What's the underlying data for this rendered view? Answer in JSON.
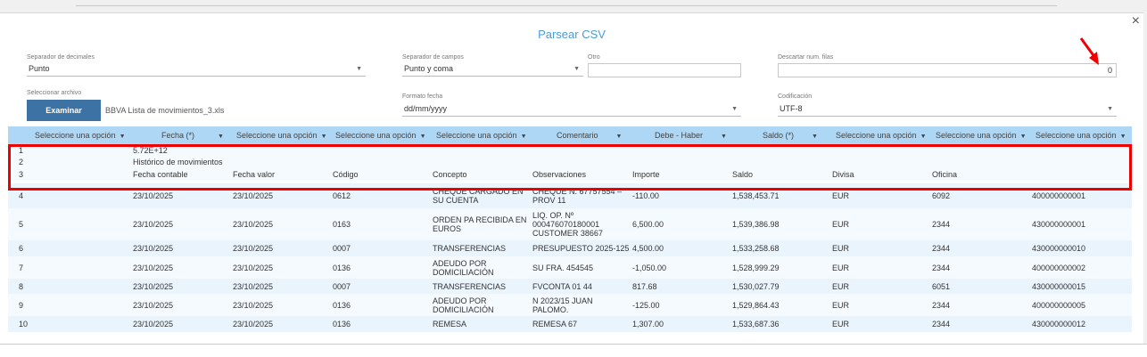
{
  "dialog": {
    "title": "Parsear CSV",
    "close": "×"
  },
  "form": {
    "decimal_sep": {
      "label": "Separador de decimales",
      "value": "Punto"
    },
    "field_sep": {
      "label": "Separador de campos",
      "value": "Punto y coma"
    },
    "other": {
      "label": "Otro",
      "value": ""
    },
    "skip_rows": {
      "label": "Descartar num. filas",
      "value": "0"
    },
    "file": {
      "label": "Seleccionar archivo",
      "button": "Examinar",
      "filename": "BBVA Lista de movimientos_3.xls"
    },
    "date_format": {
      "label": "Formato fecha",
      "value": "dd/mm/yyyy"
    },
    "encoding": {
      "label": "Codificación",
      "value": "UTF-8"
    }
  },
  "columns": [
    {
      "label": "Seleccione una opción"
    },
    {
      "label": "Fecha (*)"
    },
    {
      "label": "Seleccione una opción"
    },
    {
      "label": "Seleccione una opción"
    },
    {
      "label": "Seleccione una opción"
    },
    {
      "label": "Comentario"
    },
    {
      "label": "Debe - Haber"
    },
    {
      "label": "Saldo (*)"
    },
    {
      "label": "Seleccione una opción"
    },
    {
      "label": "Seleccione una opción"
    },
    {
      "label": "Seleccione una opción"
    }
  ],
  "rows": [
    [
      "1",
      "5.72E+12",
      "",
      "",
      "",
      "",
      "",
      "",
      "",
      "",
      ""
    ],
    [
      "2",
      "Histórico de movimientos",
      "",
      "",
      "",
      "",
      "",
      "",
      "",
      "",
      ""
    ],
    [
      "3",
      "Fecha contable",
      "Fecha valor",
      "Código",
      "Concepto",
      "Observaciones",
      "Importe",
      "Saldo",
      "Divisa",
      "Oficina",
      ""
    ],
    [
      "4",
      "23/10/2025",
      "23/10/2025",
      "0612",
      "CHEQUE CARGADO EN SU CUENTA",
      "CHEQUE N. 67757554 – PROV 11",
      "-110.00",
      "1,538,453.71",
      "EUR",
      "6092",
      "400000000001"
    ],
    [
      "5",
      "23/10/2025",
      "23/10/2025",
      "0163",
      "ORDEN PA RECIBIDA EN EUROS",
      "LIQ. OP. Nº 000476070180001 CUSTOMER 38667",
      "6,500.00",
      "1,539,386.98",
      "EUR",
      "2344",
      "430000000001"
    ],
    [
      "6",
      "23/10/2025",
      "23/10/2025",
      "0007",
      "TRANSFERENCIAS",
      "PRESUPUESTO 2025-125",
      "4,500.00",
      "1,533,258.68",
      "EUR",
      "2344",
      "430000000010"
    ],
    [
      "7",
      "23/10/2025",
      "23/10/2025",
      "0136",
      "ADEUDO POR DOMICILIACIÓN",
      "SU FRA. 454545",
      "-1,050.00",
      "1,528,999.29",
      "EUR",
      "2344",
      "400000000002"
    ],
    [
      "8",
      "23/10/2025",
      "23/10/2025",
      "0007",
      "TRANSFERENCIAS",
      "FVCONTA 01 44",
      "817.68",
      "1,530,027.79",
      "EUR",
      "6051",
      "430000000015"
    ],
    [
      "9",
      "23/10/2025",
      "23/10/2025",
      "0136",
      "ADEUDO POR DOMICILIACIÓN",
      "N 2023/15 JUAN PALOMO.",
      "-125.00",
      "1,529,864.43",
      "EUR",
      "2344",
      "400000000005"
    ],
    [
      "10",
      "23/10/2025",
      "23/10/2025",
      "0136",
      "REMESA",
      "REMESA 67",
      "1,307.00",
      "1,533,687.36",
      "EUR",
      "2344",
      "430000000012"
    ]
  ],
  "colors": {
    "accent": "#4a9bd6",
    "button": "#3d73a4",
    "header": "#aed6f5",
    "highlight": "#e00000"
  }
}
